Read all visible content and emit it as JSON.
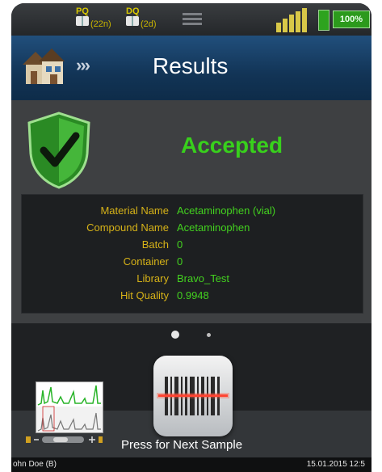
{
  "status_bar": {
    "indicators": [
      {
        "label": "PQ",
        "count": "(22n)"
      },
      {
        "label": "DQ",
        "count": "(2d)"
      }
    ],
    "menu_icon": "menu-icon",
    "signal_icon": "signal-bars-icon",
    "battery_icon": "battery-icon",
    "battery": "100%"
  },
  "header": {
    "home_icon": "home-icon",
    "chevrons": "›››",
    "title": "Results"
  },
  "result": {
    "status": "Accepted",
    "status_color": "#38d01c",
    "icon": "shield-check-icon",
    "fields": [
      {
        "label": "Material Name",
        "value": "Acetaminophen (vial)"
      },
      {
        "label": "Compound Name",
        "value": "Acetaminophen"
      },
      {
        "label": "Batch",
        "value": "0"
      },
      {
        "label": "Container",
        "value": "0"
      },
      {
        "label": "Library",
        "value": "Bravo_Test"
      },
      {
        "label": "Hit Quality",
        "value": "0.9948"
      }
    ]
  },
  "pager": {
    "page_count": 2,
    "current": 1
  },
  "scan": {
    "button_icon": "barcode-scan-icon",
    "label": "Press for Next Sample"
  },
  "spectrum": {
    "icon": "spectrum-thumbnail-icon"
  },
  "footer": {
    "user": "ohn Doe (B)",
    "datetime": "15.01.2015 12:5"
  }
}
